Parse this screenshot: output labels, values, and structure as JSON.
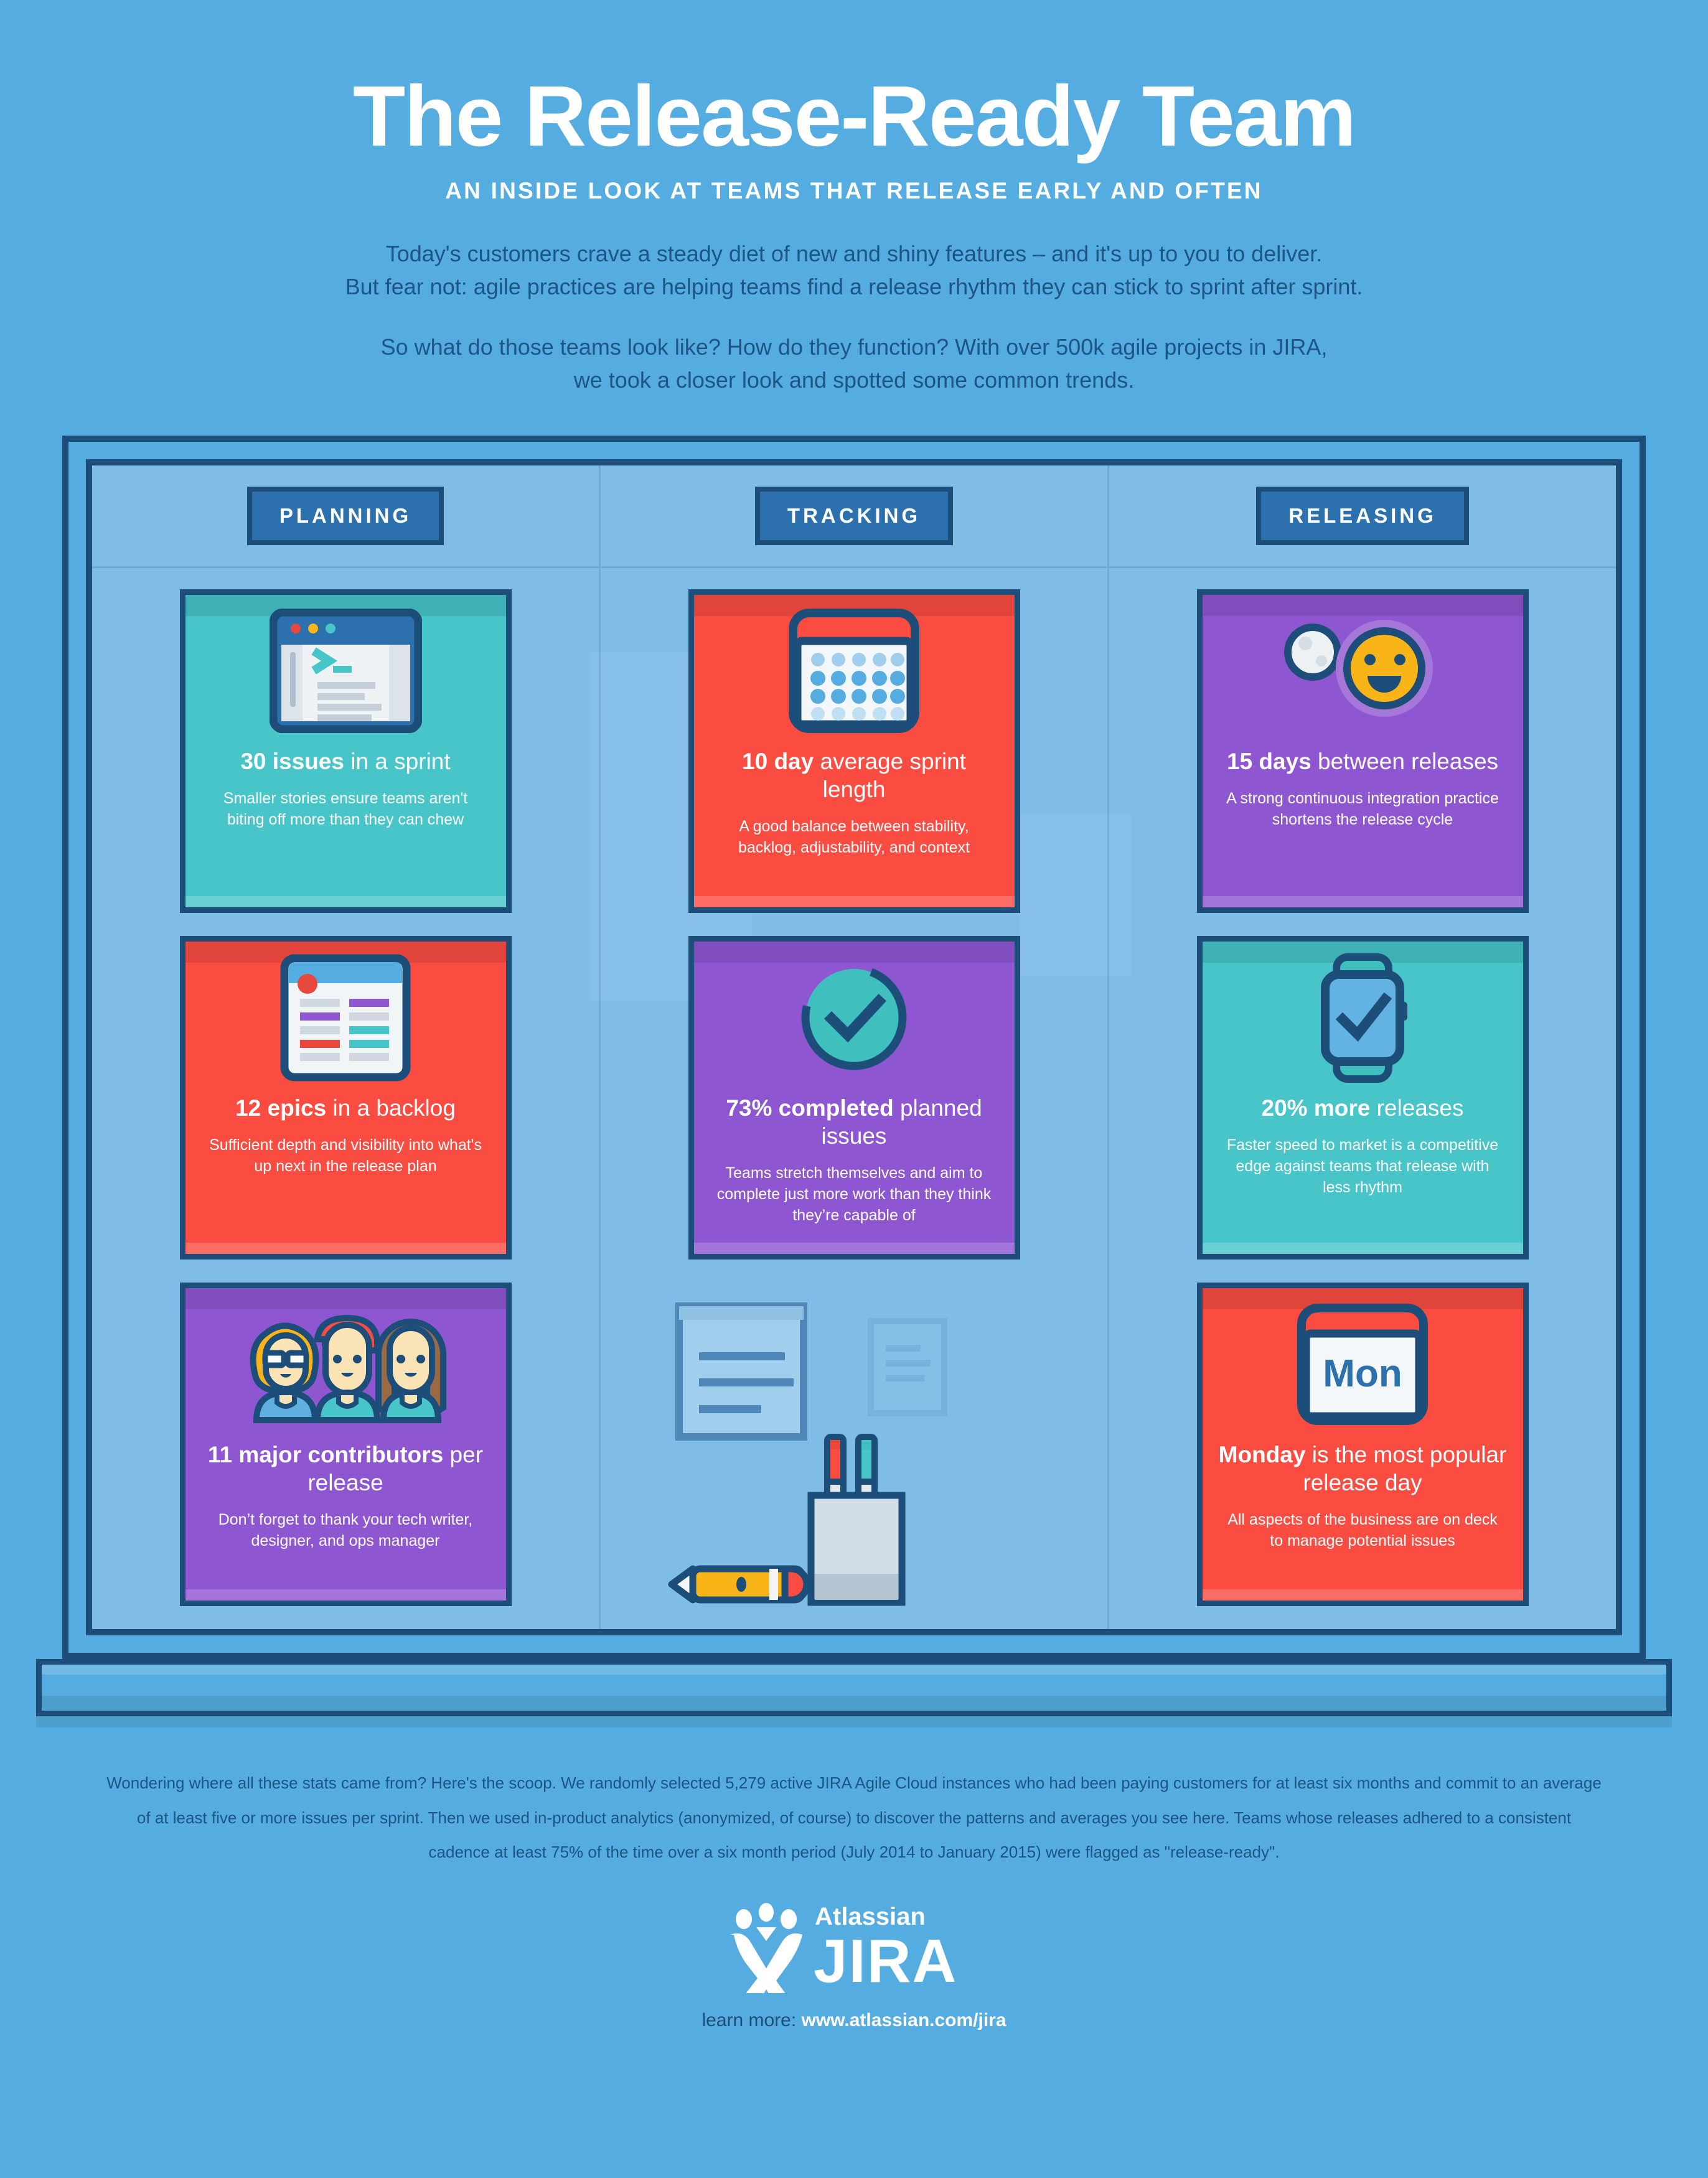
{
  "header": {
    "title": "The Release-Ready Team",
    "subtitle": "AN INSIDE LOOK AT TEAMS THAT RELEASE EARLY AND OFTEN",
    "intro_line1": "Today's customers crave a steady diet of new and shiny features – and it's up to you to deliver.",
    "intro_line2": "But fear not: agile practices are helping teams find a release rhythm they can stick to sprint after sprint.",
    "intro_line3": "So what do those teams look like? How do they function? With over 500k agile projects in JIRA,",
    "intro_line4": "we took a closer look and spotted some common trends."
  },
  "board": {
    "columns": [
      {
        "header": "PLANNING",
        "cards": [
          {
            "icon": "browser-window-icon",
            "color": "#47C5C8",
            "stat_bold": "30 issues",
            "stat_rest": " in a sprint",
            "desc": "Smaller stories ensure teams aren't biting off more than they can chew"
          },
          {
            "icon": "backlog-board-icon",
            "color": "#FB4C42",
            "stat_bold": "12 epics",
            "stat_rest": " in a backlog",
            "desc": "Sufficient depth and visibility into what's up next in the release plan"
          },
          {
            "icon": "contributors-avatars-icon",
            "color": "#8F56D2",
            "stat_bold": "11 major contributors",
            "stat_rest": " per release",
            "desc": "Don’t forget to thank your tech writer, designer, and ops manager"
          }
        ]
      },
      {
        "header": "TRACKING",
        "cards": [
          {
            "icon": "calendar-icon",
            "color": "#FB4C42",
            "stat_bold": "10 day",
            "stat_rest": " average sprint length",
            "desc": "A good balance between stability, backlog, adjustability, and context"
          },
          {
            "icon": "checkmark-progress-icon",
            "color": "#8F56D2",
            "stat_bold": "73% completed",
            "stat_rest": " planned issues",
            "desc": "Teams stretch themselves and aim to complete just more work than they think they’re capable of"
          }
        ],
        "decor": [
          "sticky-note-icon",
          "small-paper-icon",
          "pen-cup-icon",
          "pencil-icon"
        ]
      },
      {
        "header": "RELEASING",
        "cards": [
          {
            "icon": "moon-and-sun-icon",
            "color": "#8F56D2",
            "stat_bold": "15 days",
            "stat_rest": " between releases",
            "desc": "A strong continuous integration practice shortens the release cycle"
          },
          {
            "icon": "smartwatch-icon",
            "color": "#47C5C8",
            "stat_bold": "20% more",
            "stat_rest": " releases",
            "desc": "Faster speed to market is a competitive edge against teams that release with less rhythm"
          },
          {
            "icon": "monday-calendar-icon",
            "color": "#FB4C42",
            "icon_label": "Mon",
            "stat_bold": "Monday",
            "stat_rest": " is the most popular release day",
            "desc": "All aspects of the business are on deck to manage potential issues"
          }
        ]
      }
    ]
  },
  "footer": {
    "methodology": "Wondering where all these stats came from? Here's the scoop. We randomly selected 5,279 active JIRA Agile Cloud instances who had been paying customers for at least six months and commit to an average of at least five or more issues per sprint. Then we used in-product analytics (anonymized, of course) to discover the patterns and averages you see here. Teams whose releases adhered to a consistent cadence at least 75% of the time over a six month period (July 2014 to January 2015) were flagged as \"release-ready\".",
    "brand_top": "Atlassian",
    "brand_main": "JIRA",
    "learn_label": "learn more: ",
    "learn_url": "www.atlassian.com/jira"
  },
  "colors": {
    "page_bg": "#55ACE0",
    "board_bg": "#7FBCE6",
    "navy": "#1D4E79",
    "chip_blue": "#2C70AD",
    "teal": "#47C5C8",
    "red": "#FB4C42",
    "purple": "#8F56D2",
    "yellow": "#F9B418",
    "white": "#FFFFFF"
  }
}
